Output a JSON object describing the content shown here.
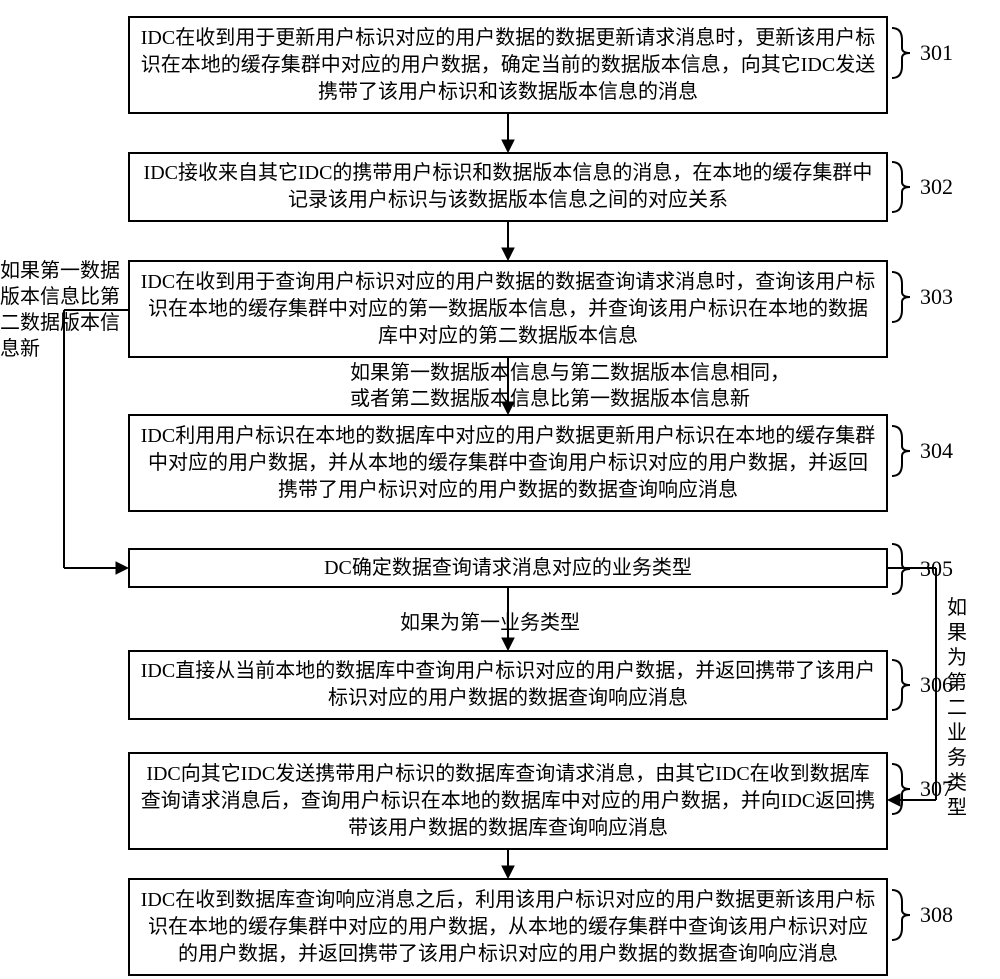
{
  "steps": {
    "s301": "IDC在收到用于更新用户标识对应的用户数据的数据更新请求消息时，更新该用户标识在本地的缓存集群中对应的用户数据，确定当前的数据版本信息，向其它IDC发送携带了该用户标识和该数据版本信息的消息",
    "s302": "IDC接收来自其它IDC的携带用户标识和数据版本信息的消息，在本地的缓存集群中记录该用户标识与该数据版本信息之间的对应关系",
    "s303": "IDC在收到用于查询用户标识对应的用户数据的数据查询请求消息时，查询该用户标识在本地的缓存集群中对应的第一数据版本信息，并查询该用户标识在本地的数据库中对应的第二数据版本信息",
    "s304": "IDC利用用户标识在本地的数据库中对应的用户数据更新用户标识在本地的缓存集群中对应的用户数据，并从本地的缓存集群中查询用户标识对应的用户数据，并返回携带了用户标识对应的用户数据的数据查询响应消息",
    "s305": "DC确定数据查询请求消息对应的业务类型",
    "s306": "IDC直接从当前本地的数据库中查询用户标识对应的用户数据，并返回携带了该用户标识对应的用户数据的数据查询响应消息",
    "s307": "IDC向其它IDC发送携带用户标识的数据库查询请求消息，由其它IDC在收到数据库查询请求消息后，查询用户标识在本地的数据库中对应的用户数据，并向IDC返回携带该用户数据的数据库查询响应消息",
    "s308": "IDC在收到数据库查询响应消息之后，利用该用户标识对应的用户数据更新该用户标识在本地的缓存集群中对应的用户数据，从本地的缓存集群中查询该用户标识对应的用户数据，并返回携带了该用户标识对应的用户数据的数据查询响应消息"
  },
  "labels": {
    "l301": "301",
    "l302": "302",
    "l303": "303",
    "l304": "304",
    "l305": "305",
    "l306": "306",
    "l307": "307",
    "l308": "308"
  },
  "annotations": {
    "a_left": "如果第一数据\n版本信息比第\n二数据版本信\n息新",
    "a_3_4": "如果第一数据版本信息与第二数据版本信息相同，\n或者第二数据版本信息比第一数据版本信息新",
    "a_5_6": "如果为第一业务类型",
    "a_right": "如果为第二业务类型"
  }
}
